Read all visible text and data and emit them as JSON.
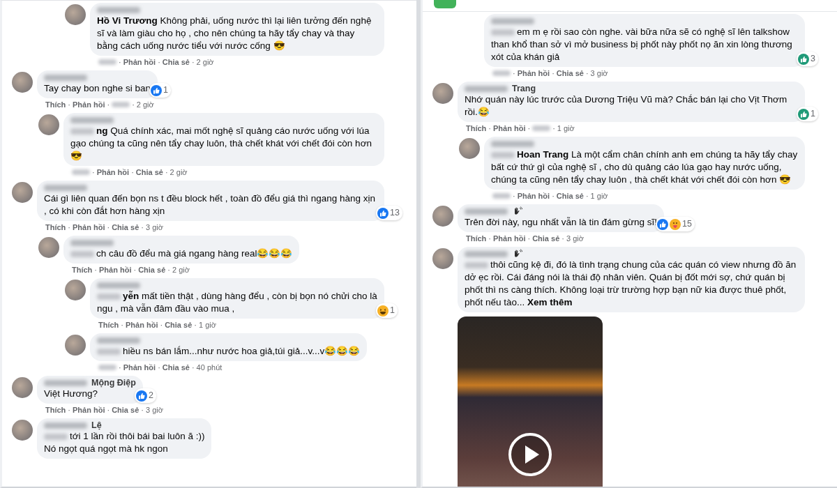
{
  "separator": "·",
  "panels": [
    {
      "header": false,
      "comments": [
        {
          "children": [
            {
              "children": [
                {
                  "name_blur": true,
                  "mention": "Hồ Vi Trương",
                  "text": "Không phải, uống nước thì lại liên tưởng đến nghệ sĩ và làm giàu cho họ , cho nên chúng ta hãy tẩy chay và thay bằng cách uống nước tiểu với nước cống 😎",
                  "actions": [
                    {
                      "blurred": true
                    },
                    {
                      "label": "Phản hồi"
                    },
                    {
                      "label": "Chia sẻ"
                    }
                  ],
                  "time": "2 giờ"
                }
              ]
            }
          ]
        },
        {
          "name_blur": true,
          "text": "Tay chay bon nghe si ban",
          "reaction": {
            "icons": [
              {
                "kind": "like",
                "color": "#1877f2"
              }
            ],
            "count": "1"
          },
          "actions": [
            {
              "label": "Thích"
            },
            {
              "label": "Phản hồi"
            },
            {
              "blurred": true
            }
          ],
          "time": "2 giờ",
          "children": [
            {
              "name_blur": true,
              "lead_blur": true,
              "mention": "ng",
              "text": "Quá chính xác, mai mốt nghệ sĩ quảng cáo nước uống với lúa gạo chúng ta cũng nên tẩy chay luôn, thà chết khát với chết đói còn hơn 😎",
              "actions": [
                {
                  "blurred": true
                },
                {
                  "label": "Phản hồi"
                },
                {
                  "label": "Chia sẻ"
                }
              ],
              "time": "2 giờ"
            }
          ]
        },
        {
          "name_blur": true,
          "text": "Cái gì liên quan đến bọn ns t đều block hết , toàn đồ đểu giá thì ngang hàng xịn , có khi còn đắt hơn hàng xịn",
          "reaction": {
            "icons": [
              {
                "kind": "like",
                "color": "#1877f2"
              }
            ],
            "count": "13"
          },
          "actions": [
            {
              "label": "Thích"
            },
            {
              "label": "Phản hồi"
            },
            {
              "label": "Chia sẻ"
            }
          ],
          "time": "3 giờ",
          "children": [
            {
              "name_blur": true,
              "lead_blur": true,
              "text": "ch câu đồ đểu mà giá ngang hàng real😂😂😂",
              "actions": [
                {
                  "label": "Thích"
                },
                {
                  "label": "Phản hồi"
                },
                {
                  "label": "Chia sẻ"
                }
              ],
              "time": "2 giờ",
              "children": [
                {
                  "name_blur": true,
                  "lead_blur": true,
                  "mention": "yễn",
                  "text": "mất tiền thật , dùng hàng đểu , còn bị bọn nó chửi cho là ngu , mà vẫn đâm đầu vào mua ,",
                  "reaction": {
                    "icons": [
                      {
                        "kind": "haha",
                        "color": "#f7b125"
                      }
                    ],
                    "count": "1"
                  },
                  "actions": [
                    {
                      "label": "Thích"
                    },
                    {
                      "label": "Phản hồi"
                    },
                    {
                      "label": "Chia sẻ"
                    }
                  ],
                  "time": "1 giờ"
                },
                {
                  "name_blur": true,
                  "lead_blur": true,
                  "text": "hiều ns bán lắm...như nước hoa giả,túi giả...v...v😂😂😂",
                  "actions": [
                    {
                      "blurred": true
                    },
                    {
                      "label": "Phản hồi"
                    },
                    {
                      "label": "Chia sẻ"
                    }
                  ],
                  "time": "40 phút"
                }
              ]
            }
          ]
        },
        {
          "name_blur": true,
          "name": "Mộng Điệp",
          "text": "Việt Hương?",
          "reaction": {
            "icons": [
              {
                "kind": "like",
                "color": "#1877f2"
              }
            ],
            "count": "2"
          },
          "actions": [
            {
              "label": "Thích"
            },
            {
              "label": "Phản hồi"
            },
            {
              "label": "Chia sẻ"
            }
          ],
          "time": "3 giờ"
        },
        {
          "name_blur": true,
          "name": "Lệ",
          "lead_blur": true,
          "text": "tới 1 lần rồi thôi bái bai luôn ă :))\nNó ngọt quá ngọt mà hk ngon"
        }
      ]
    },
    {
      "header": true,
      "comments": [
        {
          "children": [
            {
              "name_blur": true,
              "hide_avatar": true,
              "lead_blur": true,
              "text": "em m ẹ rồi sao còn nghe. vài bữa nữa sẽ có nghệ sĩ lên talkshow than khổ than sở vì mở business bị phốt này phốt nọ ăn xin lòng thương xót của khán giả",
              "reaction": {
                "icons": [
                  {
                    "kind": "like",
                    "color": "#1f9a78"
                  }
                ],
                "count": "3"
              },
              "actions": [
                {
                  "blurred": true
                },
                {
                  "label": "Phản hồi"
                },
                {
                  "label": "Chia sẻ"
                }
              ],
              "time": "3 giờ"
            }
          ]
        },
        {
          "name_blur": true,
          "name": "Trang",
          "text": "Nhớ quán này lúc trước của Dương Triệu Vũ mà? Chắc bán lại cho Vịt Thơm rồi.😂",
          "reaction": {
            "icons": [
              {
                "kind": "like",
                "color": "#1f9a78"
              }
            ],
            "count": "1"
          },
          "actions": [
            {
              "label": "Thích"
            },
            {
              "label": "Phản hồi"
            },
            {
              "blurred": true
            }
          ],
          "time": "1 giờ",
          "children": [
            {
              "name_blur": true,
              "lead_blur": true,
              "mention": "Hoan Trang",
              "text": "Là một cẩm chân chính anh em chúng ta hãy tẩy chay bất cứ thứ gì của nghệ sĩ , cho dù quảng cáo lúa gạo hay nước uống, chúng ta cũng nên tẩy chay luôn , thà chết khát với chết đói còn hơn 😎",
              "actions": [
                {
                  "blurred": true
                },
                {
                  "label": "Phản hồi"
                },
                {
                  "label": "Chia sẻ"
                }
              ],
              "time": "1 giờ"
            }
          ]
        },
        {
          "name_blur": true,
          "wave": true,
          "text": "Trên đời này, ngu nhất vẫn là tin đám gừng sĩ!",
          "reaction": {
            "icons": [
              {
                "kind": "like",
                "color": "#1877f2"
              },
              {
                "kind": "care",
                "color": "#f7b125"
              }
            ],
            "count": "15"
          },
          "actions": [
            {
              "label": "Thích"
            },
            {
              "label": "Phản hồi"
            },
            {
              "label": "Chia sẻ"
            }
          ],
          "time": "3 giờ"
        },
        {
          "name_blur": true,
          "wave": true,
          "lead_blur": true,
          "text": "thôi cũng kệ đi, đó là tình trạng chung của các quán có view nhưng đồ ăn dở ẹc rồi. Cái đáng nói là thái độ nhân viên. Quán bị đốt mới sợ, chứ quán bị phốt thì ns càng thích. Không loại trừ trường hợp bạn nữ kia được thuê phốt, phốt nếu tào...",
          "more": "Xem thêm",
          "attachment": {
            "kind": "video"
          }
        }
      ]
    }
  ]
}
